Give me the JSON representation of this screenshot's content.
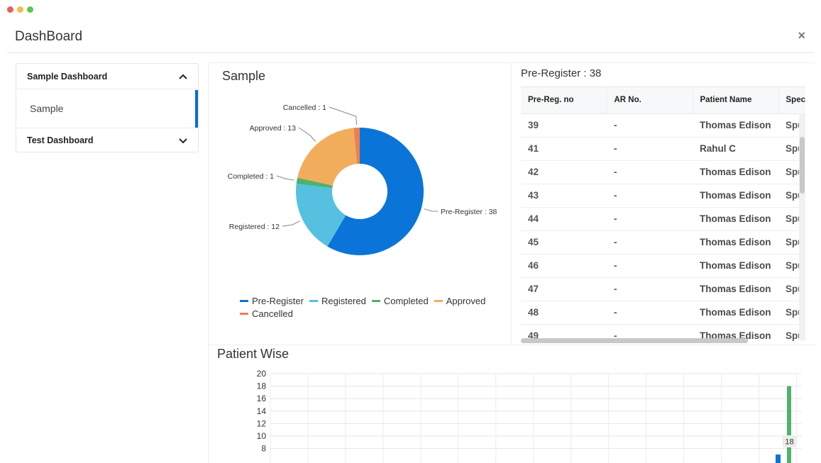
{
  "window": {
    "dots": [
      "#ec5f57",
      "#f4bd4f",
      "#5fc454"
    ]
  },
  "header": {
    "title": "DashBoard",
    "close_symbol": "×"
  },
  "sidebar": {
    "sections": [
      {
        "label": "Sample Dashboard",
        "expanded": true,
        "items": [
          {
            "label": "Sample",
            "active": true
          }
        ]
      },
      {
        "label": "Test Dashboard",
        "expanded": false,
        "items": []
      }
    ]
  },
  "sample_panel": {
    "title": "Sample"
  },
  "chart_data": [
    {
      "type": "pie",
      "variant": "donut",
      "labels": [
        "Pre-Register",
        "Registered",
        "Completed",
        "Approved",
        "Cancelled"
      ],
      "values": [
        38,
        12,
        1,
        13,
        1
      ],
      "colors": [
        "#0b74d8",
        "#55c0e0",
        "#4fb26b",
        "#f2ad5c",
        "#ec7f4e"
      ],
      "slice_labels": [
        "Pre-Register : 38",
        "Registered : 12",
        "Completed : 1",
        "Approved : 13",
        "Cancelled : 1"
      ],
      "legend": "bottom"
    },
    {
      "type": "bar",
      "title": "Patient Wise",
      "ylim": [
        8,
        20
      ],
      "y_ticks": [
        20,
        18,
        16,
        14,
        12,
        10,
        8
      ],
      "grid": true,
      "visible_bar_value": 18,
      "visible_bar_label": "18",
      "colors": {
        "main": "#4fb26b",
        "secondary": "#0b74d8"
      }
    }
  ],
  "table_panel": {
    "title": "Pre-Register : 38",
    "columns": [
      "Pre-Reg. no",
      "AR No.",
      "Patient Name",
      "Spec"
    ],
    "rows": [
      [
        "39",
        "-",
        "Thomas Edison",
        "Spu"
      ],
      [
        "41",
        "-",
        "Rahul C",
        "Spu"
      ],
      [
        "42",
        "-",
        "Thomas Edison",
        "Spu"
      ],
      [
        "43",
        "-",
        "Thomas Edison",
        "Spu"
      ],
      [
        "44",
        "-",
        "Thomas Edison",
        "Spu"
      ],
      [
        "45",
        "-",
        "Thomas Edison",
        "Spu"
      ],
      [
        "46",
        "-",
        "Thomas Edison",
        "Spu"
      ],
      [
        "47",
        "-",
        "Thomas Edison",
        "Spu"
      ],
      [
        "48",
        "-",
        "Thomas Edison",
        "Spu"
      ],
      [
        "49",
        "-",
        "Thomas Edison",
        "Spu"
      ]
    ]
  }
}
